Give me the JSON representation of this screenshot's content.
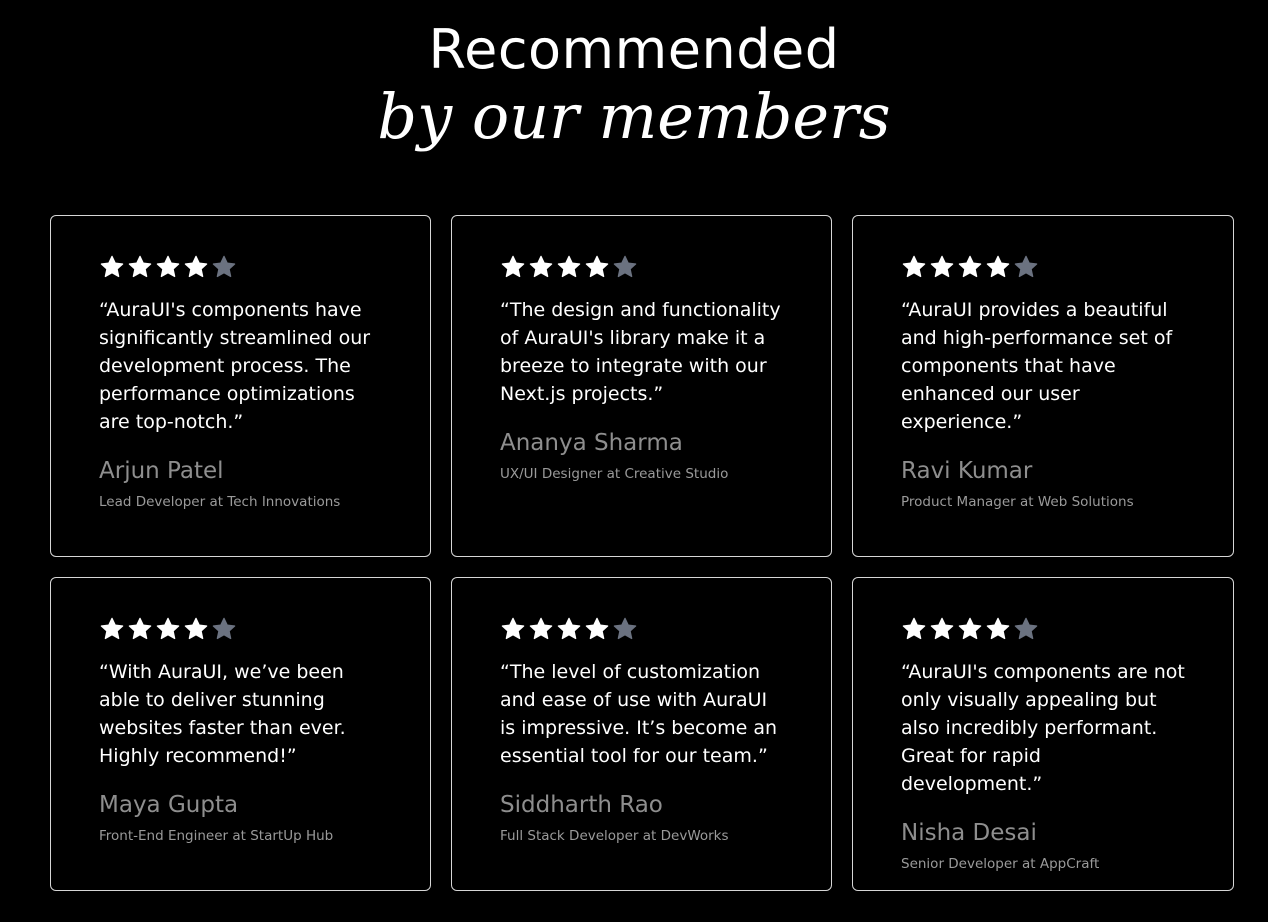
{
  "heading": {
    "line1": "Recommended",
    "line2": "by our members"
  },
  "colors": {
    "background": "#000000",
    "card_border": "#d6d6d6",
    "star_filled": "#ffffff",
    "star_empty": "#6b7280",
    "name_text": "#8e8e8e"
  },
  "testimonials": [
    {
      "rating": 4,
      "max_rating": 5,
      "quote": "“AuraUI's components have significantly streamlined our development process. The performance optimizations are top-notch.”",
      "name": "Arjun Patel",
      "role": "Lead Developer at Tech Innovations"
    },
    {
      "rating": 4,
      "max_rating": 5,
      "quote": "“The design and functionality of AuraUI's library make it a breeze to integrate with our Next.js projects.”",
      "name": "Ananya Sharma",
      "role": "UX/UI Designer at Creative Studio"
    },
    {
      "rating": 4,
      "max_rating": 5,
      "quote": "“AuraUI provides a beautiful and high-performance set of components that have enhanced our user experience.”",
      "name": "Ravi Kumar",
      "role": "Product Manager at Web Solutions"
    },
    {
      "rating": 4,
      "max_rating": 5,
      "quote": "“With AuraUI, we’ve been able to deliver stunning websites faster than ever. Highly recommend!”",
      "name": "Maya Gupta",
      "role": "Front-End Engineer at StartUp Hub"
    },
    {
      "rating": 4,
      "max_rating": 5,
      "quote": "“The level of customization and ease of use with AuraUI is impressive. It’s become an essential tool for our team.”",
      "name": "Siddharth Rao",
      "role": "Full Stack Developer at DevWorks"
    },
    {
      "rating": 4,
      "max_rating": 5,
      "quote": "“AuraUI's components are not only visually appealing but also incredibly performant. Great for rapid development.”",
      "name": "Nisha Desai",
      "role": "Senior Developer at AppCraft"
    }
  ]
}
